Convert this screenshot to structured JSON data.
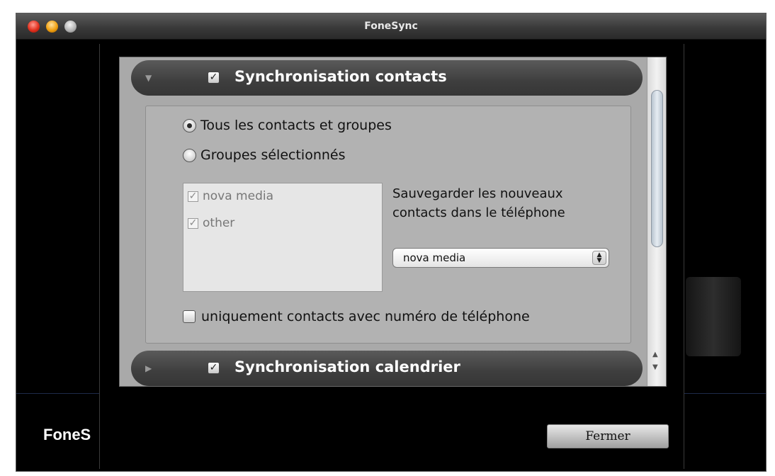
{
  "window": {
    "title": "FoneSync"
  },
  "background": {
    "logo_text": "FoneS"
  },
  "sections": {
    "contacts": {
      "label": "Synchronisation contacts",
      "checked": true,
      "expanded": true,
      "options": {
        "all_label": "Tous les contacts et groupes",
        "selected_label": "Groupes sélectionnés",
        "selected_option": "all"
      },
      "groups": [
        {
          "label": "nova media",
          "checked": true
        },
        {
          "label": "other",
          "checked": true
        }
      ],
      "save_text_line1": "Sauvegarder les nouveaux",
      "save_text_line2": "contacts dans le téléphone",
      "save_target": "nova media",
      "phone_only_label": "uniquement contacts avec numéro de téléphone",
      "phone_only_checked": false
    },
    "calendar": {
      "label": "Synchronisation calendrier",
      "checked": true,
      "expanded": false
    }
  },
  "buttons": {
    "close_label": "Fermer"
  }
}
